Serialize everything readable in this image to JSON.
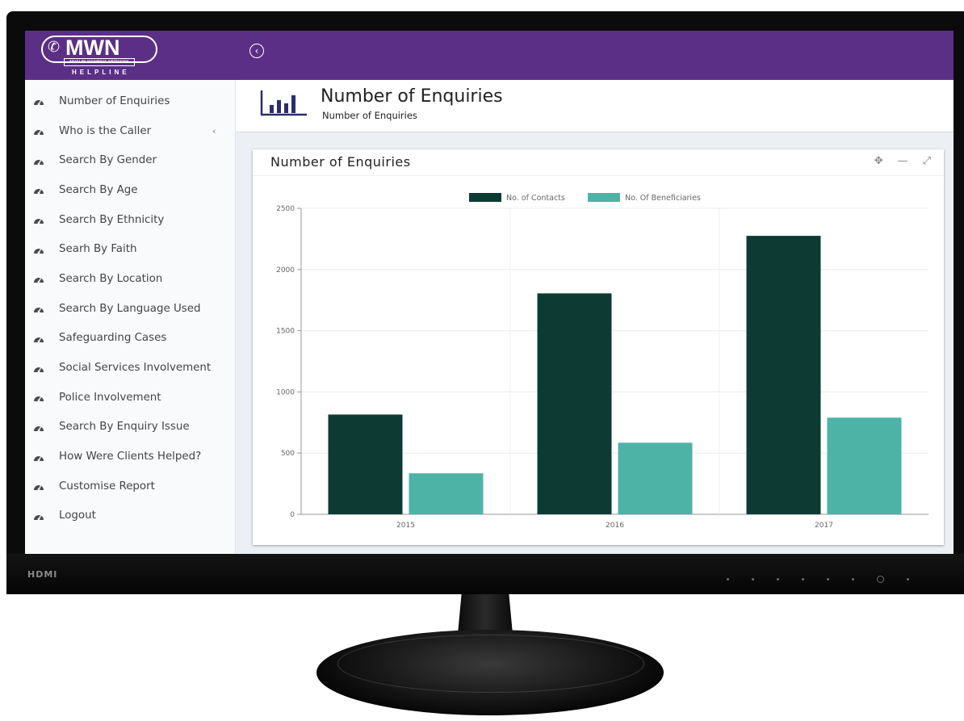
{
  "app": {
    "logo_text": "MWN",
    "logo_subtext": "MUSLIM WOMEN'S NETWORK",
    "logo_tagline": "HELPLINE",
    "header_color": "#5c2f86"
  },
  "sidebar": {
    "items": [
      {
        "label": "Number of Enquiries",
        "icon": "dashboard-icon"
      },
      {
        "label": "Who is the Caller",
        "icon": "dashboard-icon",
        "has_submenu": true
      },
      {
        "label": "Search By Gender",
        "icon": "dashboard-icon"
      },
      {
        "label": "Search By Age",
        "icon": "dashboard-icon"
      },
      {
        "label": "Search By Ethnicity",
        "icon": "dashboard-icon"
      },
      {
        "label": "Searh By Faith",
        "icon": "dashboard-icon"
      },
      {
        "label": "Search By Location",
        "icon": "dashboard-icon"
      },
      {
        "label": "Search By Language Used",
        "icon": "dashboard-icon"
      },
      {
        "label": "Safeguarding Cases",
        "icon": "dashboard-icon"
      },
      {
        "label": "Social Services Involvement",
        "icon": "dashboard-icon"
      },
      {
        "label": "Police Involvement",
        "icon": "dashboard-icon"
      },
      {
        "label": "Search By Enquiry Issue",
        "icon": "dashboard-icon"
      },
      {
        "label": "How Were Clients Helped?",
        "icon": "dashboard-icon"
      },
      {
        "label": "Customise Report",
        "icon": "dashboard-icon"
      },
      {
        "label": "Logout",
        "icon": "dashboard-icon"
      }
    ]
  },
  "page": {
    "title": "Number of Enquiries",
    "subtitle": "Number of Enquiries"
  },
  "chart_box": {
    "title": "Number of Enquiries",
    "tools": [
      "move-icon",
      "minimize-icon",
      "fullscreen-icon"
    ]
  },
  "monitor": {
    "port_label": "HDMI"
  },
  "chart_data": {
    "type": "bar",
    "categories": [
      "2015",
      "2016",
      "2017"
    ],
    "series": [
      {
        "name": "No. of Contacts",
        "values": [
          815,
          1805,
          2275
        ],
        "color": "#0d3b34"
      },
      {
        "name": "No. Of Beneficiaries",
        "values": [
          335,
          585,
          790
        ],
        "color": "#4db3a6"
      }
    ],
    "yticks": [
      0,
      500,
      1000,
      1500,
      2000,
      2500
    ],
    "ylim": [
      0,
      2500
    ],
    "legend": "top-center",
    "grid": true
  }
}
